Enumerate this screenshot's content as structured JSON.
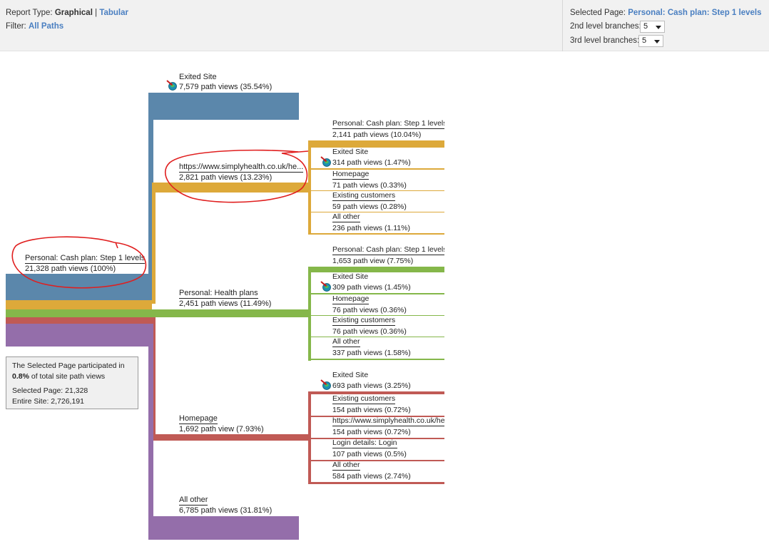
{
  "header": {
    "report_type_label": "Report Type:",
    "graphical_label": "Graphical",
    "separator": "|",
    "tabular_label": "Tabular",
    "filter_label": "Filter:",
    "filter_value": "All Paths",
    "selected_page_label": "Selected Page:",
    "selected_page_value": "Personal: Cash plan: Step 1 levels",
    "second_level_label": "2nd level branches:",
    "second_level_value": "5",
    "third_level_label": "3rd level branches:",
    "third_level_value": "5"
  },
  "root": {
    "name": "Personal: Cash plan: Step 1 levels",
    "views": "21,328 path views (100%)"
  },
  "level2": [
    {
      "name": "Exited Site",
      "views": "7,579 path views (35.54%)",
      "color": "#5b87ab"
    },
    {
      "name": "https://www.simplyhealth.co.uk/he...",
      "views": "2,821 path views (13.23%)",
      "color": "#dda93a"
    },
    {
      "name": "Personal: Health plans",
      "views": "2,451 path views (11.49%)",
      "color": "#85b74a"
    },
    {
      "name": "Homepage",
      "views": "1,692 path view (7.93%)",
      "color": "#c05a55"
    },
    {
      "name": "All other",
      "views": "6,785 path views (31.81%)",
      "color": "#946eaa"
    }
  ],
  "level3_gold": [
    {
      "name": "Personal: Cash plan: Step 1 levels",
      "views": "2,141 path views (10.04%)"
    },
    {
      "name": "Exited Site",
      "views": "314 path views (1.47%)"
    },
    {
      "name": "Homepage",
      "views": "71 path views (0.33%)"
    },
    {
      "name": "Existing customers",
      "views": "59 path views (0.28%)"
    },
    {
      "name": "All other",
      "views": "236 path views (1.11%)"
    }
  ],
  "level3_green": [
    {
      "name": "Personal: Cash plan: Step 1 levels",
      "views": "1,653 path view (7.75%)"
    },
    {
      "name": "Exited Site",
      "views": "309 path views (1.45%)"
    },
    {
      "name": "Homepage",
      "views": "76 path views (0.36%)"
    },
    {
      "name": "Existing customers",
      "views": "76 path views (0.36%)"
    },
    {
      "name": "All other",
      "views": "337 path views (1.58%)"
    }
  ],
  "level3_red": [
    {
      "name": "Exited Site",
      "views": "693 path views (3.25%)"
    },
    {
      "name": "Existing customers",
      "views": "154 path views (0.72%)"
    },
    {
      "name": "https://www.simplyhealth.co.uk/he...",
      "views": "154 path views (0.72%)"
    },
    {
      "name": "Login details: Login",
      "views": "107 path views (0.5%)"
    },
    {
      "name": "All other",
      "views": "584 path views (2.74%)"
    }
  ],
  "info": {
    "line1": "The Selected Page participated in",
    "pct": "0.8%",
    "line2_rest": "of total site  path views",
    "selected": "Selected Page: 21,328",
    "entire": "Entire Site: 2,726,191"
  },
  "icons": {
    "exit_site": "exit-site-icon"
  },
  "colors": {
    "link": "#4a7fc1",
    "annotation": "#e01e1e"
  }
}
